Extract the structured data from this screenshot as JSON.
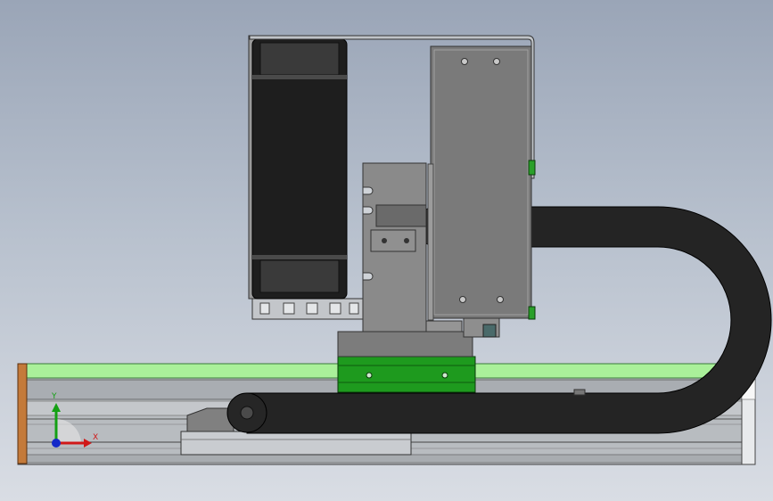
{
  "colors": {
    "background_top": "#9aa5b7",
    "background_bottom": "#d9dde4",
    "cable_chain": "#242424",
    "green_carriage": "#1e9a1e",
    "green_rail_stripe": "#aaf09a",
    "housing_gray": "#7a7a7a",
    "orange_endcap": "#c47a3a",
    "axis_x": "#d01818",
    "axis_y": "#14a014",
    "axis_z": "#1428c8"
  },
  "triad": {
    "x_label": "X",
    "y_label": "Y"
  },
  "icons": [
    "coordinate-triad-icon"
  ]
}
